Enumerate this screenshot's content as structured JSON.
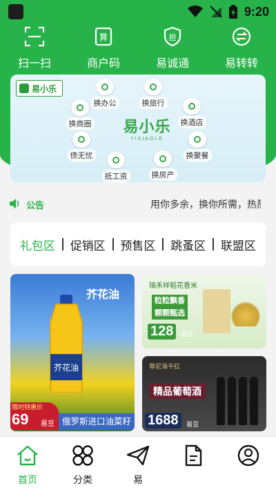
{
  "status_bar": {
    "time": "9:20"
  },
  "quick_actions": [
    {
      "label": "扫一扫",
      "icon": "scan-icon"
    },
    {
      "label": "商户码",
      "icon": "merchant-code-icon"
    },
    {
      "label": "易诚通",
      "icon": "shield-guarantee-icon"
    },
    {
      "label": "易转转",
      "icon": "transfer-icon"
    }
  ],
  "banner": {
    "logo_text": "易小乐",
    "center_title": "易小乐",
    "center_subtitle": "YIXIAOLE",
    "bubbles": [
      "换办公",
      "换旅行",
      "换酒店",
      "换聚餐",
      "换房产",
      "抵工资",
      "债无忧",
      "换商圈"
    ]
  },
  "notice": {
    "label": "公告",
    "text": "用你多余，换你所需，热烈"
  },
  "category_tabs": [
    "礼包区",
    "促销区",
    "预售区",
    "跳蚤区",
    "联盟区"
  ],
  "active_tab": 0,
  "products": {
    "oil": {
      "title": "芥花油",
      "bottle_label": "芥花油",
      "promo_tag": "限时特惠价",
      "price": "69",
      "unit": "易豆",
      "description": "俄罗斯进口油菜籽"
    },
    "rice": {
      "title": "瑞禾祥稻花香米",
      "slogan_1": "粒粒飘香",
      "slogan_2": "颗颗甄选",
      "price": "128",
      "unit": "易豆"
    },
    "wine": {
      "subtitle": "尊尼海干红",
      "title": "精品葡萄酒",
      "price": "1688",
      "unit": "易豆"
    }
  },
  "bottom_nav": [
    {
      "label": "首页",
      "icon": "home-icon"
    },
    {
      "label": "分类",
      "icon": "category-icon"
    },
    {
      "label": "易",
      "icon": "send-icon"
    },
    {
      "label": "",
      "icon": "document-icon"
    },
    {
      "label": "",
      "icon": "profile-icon"
    }
  ],
  "active_nav": 0,
  "colors": {
    "brand_green": "#27b34a",
    "text_dark": "#222222",
    "price_red": "#c81d2c"
  }
}
